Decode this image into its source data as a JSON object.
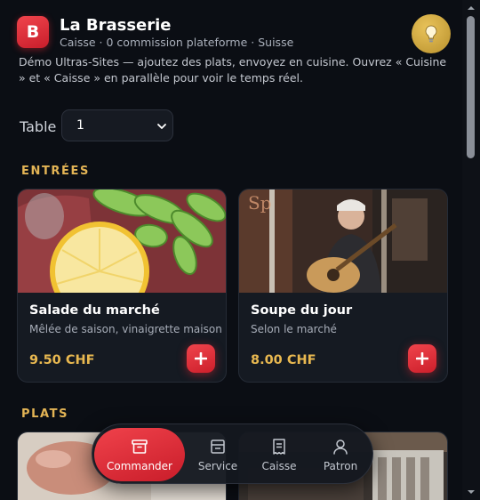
{
  "header": {
    "logo_letter": "B",
    "title": "La Brasserie",
    "subtitle": "Caisse · 0 commission plateforme · Suisse",
    "theme_icon": "lightbulb-icon"
  },
  "intro": "Démo Ultras-Sites — ajoutez des plats, envoyez en cuisine. Ouvrez « Cuisine » et « Caisse » en parallèle pour voir le temps réel.",
  "table": {
    "label": "Table",
    "value": "1"
  },
  "sections": [
    {
      "title": "ENTRÉES",
      "items": [
        {
          "name": "Salade du marché",
          "desc": "Mêlée de saison, vinaigrette maison",
          "price": "9.50 CHF",
          "image": "salad-photo"
        },
        {
          "name": "Soupe du jour",
          "desc": "Selon le marché",
          "price": "8.00 CHF",
          "image": "guitarist-photo"
        }
      ]
    },
    {
      "title": "PLATS"
    }
  ],
  "nav": [
    {
      "label": "Commander",
      "icon": "archive-box-icon",
      "active": true
    },
    {
      "label": "Service",
      "icon": "tray-icon"
    },
    {
      "label": "Caisse",
      "icon": "receipt-icon"
    },
    {
      "label": "Patron",
      "icon": "user-icon"
    }
  ],
  "colors": {
    "accent": "#e8383f",
    "gold": "#e3b455",
    "background": "#0b0e14"
  }
}
